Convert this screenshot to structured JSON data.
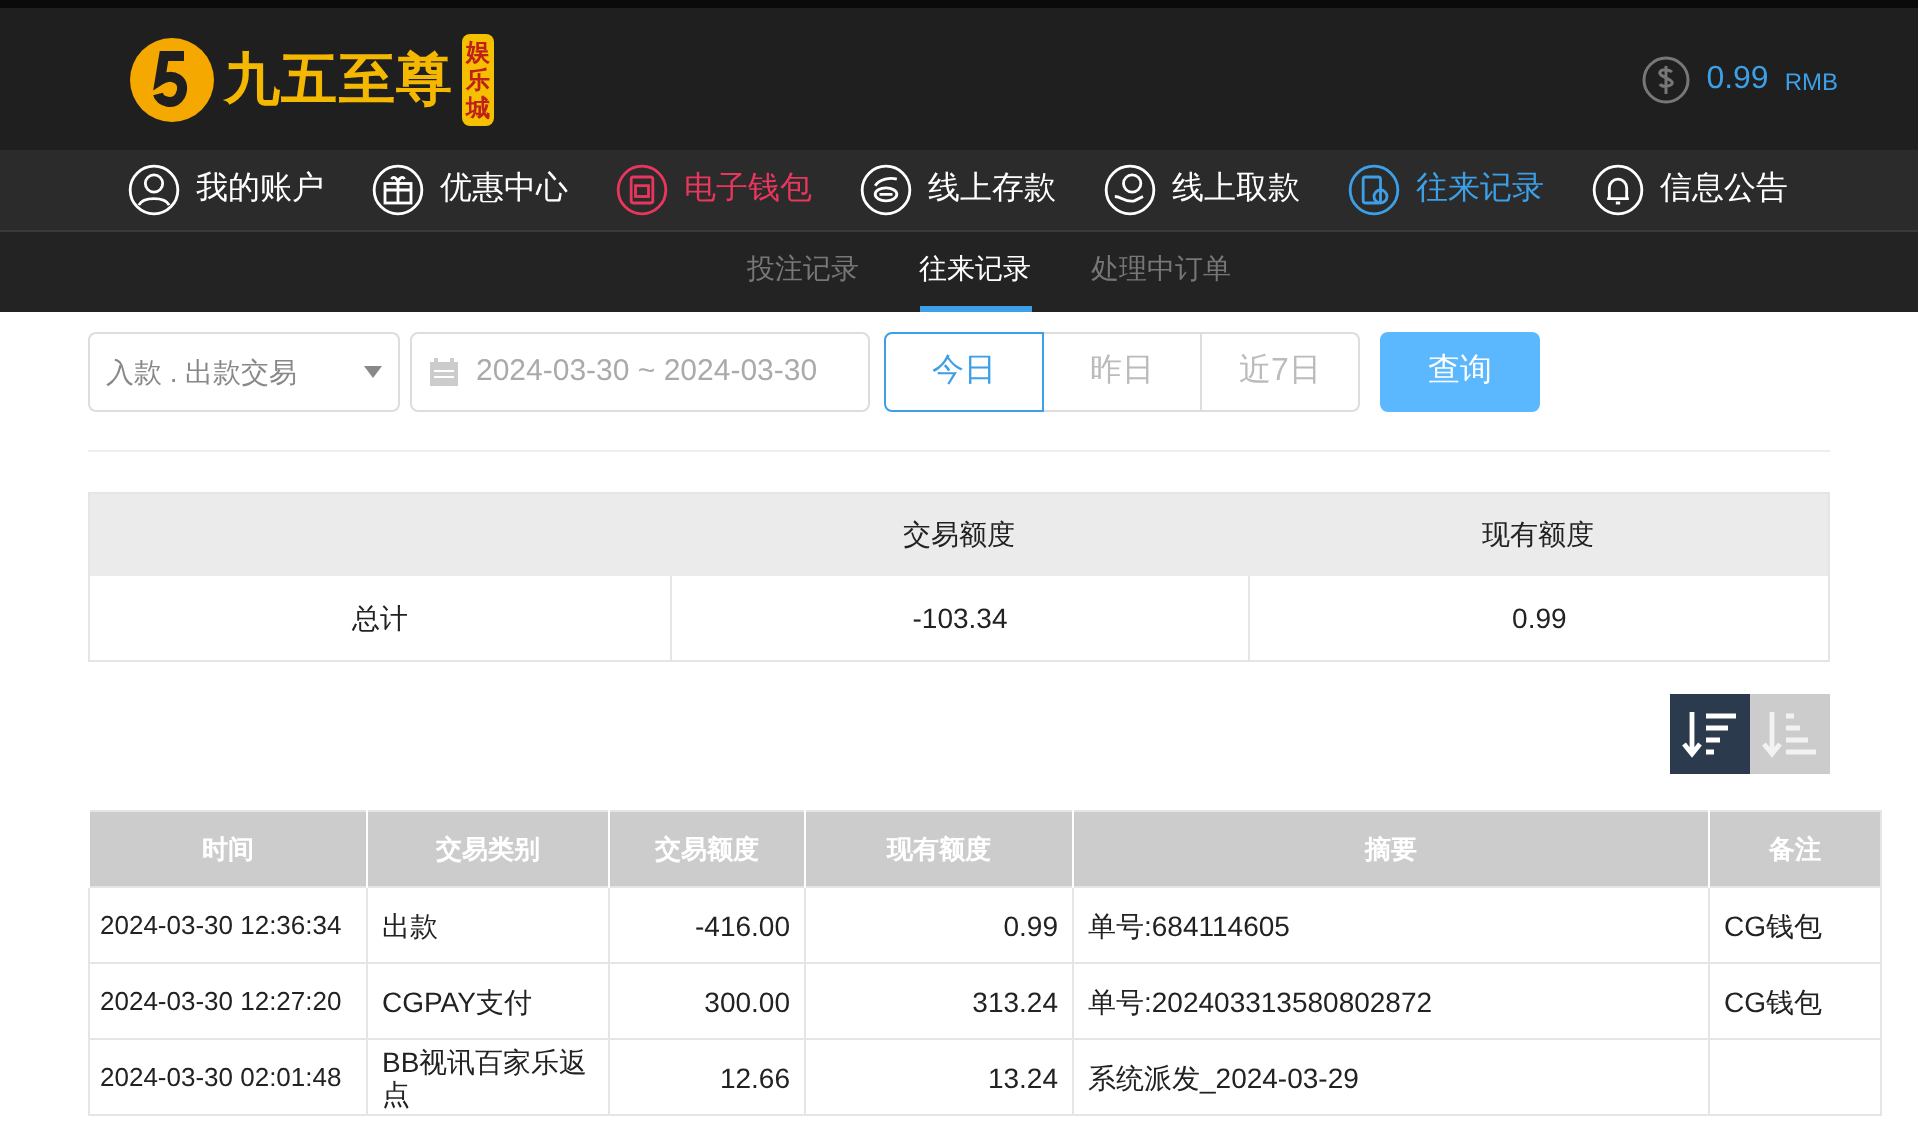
{
  "header": {
    "logo_text": "九五至尊",
    "logo_badge": "娱乐城",
    "balance": "0.99",
    "currency": "RMB"
  },
  "nav": [
    {
      "label": "我的账户",
      "color": "#ffffff"
    },
    {
      "label": "优惠中心",
      "color": "#ffffff"
    },
    {
      "label": "电子钱包",
      "color": "#e8365d"
    },
    {
      "label": "线上存款",
      "color": "#ffffff"
    },
    {
      "label": "线上取款",
      "color": "#ffffff"
    },
    {
      "label": "往来记录",
      "color": "#3d9fe6"
    },
    {
      "label": "信息公告",
      "color": "#ffffff"
    }
  ],
  "subnav": [
    {
      "label": "投注记录",
      "selected": false
    },
    {
      "label": "往来记录",
      "selected": true
    },
    {
      "label": "处理中订单",
      "selected": false
    }
  ],
  "filters": {
    "type_select": "入款 . 出款交易",
    "date_range": "2024-03-30 ~ 2024-03-30",
    "ranges": [
      {
        "label": "今日",
        "selected": true
      },
      {
        "label": "昨日",
        "selected": false
      },
      {
        "label": "近7日",
        "selected": false
      }
    ],
    "query_button": "查询"
  },
  "summary": {
    "columns": [
      "交易额度",
      "现有额度"
    ],
    "row": [
      "总计",
      "-103.34",
      "0.99"
    ]
  },
  "sort_buttons": [
    {
      "selected": true
    },
    {
      "selected": false
    }
  ],
  "table": {
    "columns": [
      "时间",
      "交易类别",
      "交易额度",
      "现有额度",
      "摘要",
      "备注"
    ],
    "rows": [
      [
        "2024-03-30 12:36:34",
        "出款",
        "-416.00",
        "0.99",
        "单号:684114605",
        "CG钱包"
      ],
      [
        "2024-03-30 12:27:20",
        "CGPAY支付",
        "300.00",
        "313.24",
        "单号:202403313580802872",
        "CG钱包"
      ],
      [
        "2024-03-30 02:01:48",
        "BB视讯百家乐返点",
        "12.66",
        "13.24",
        "系统派发_2024-03-29",
        ""
      ]
    ]
  }
}
